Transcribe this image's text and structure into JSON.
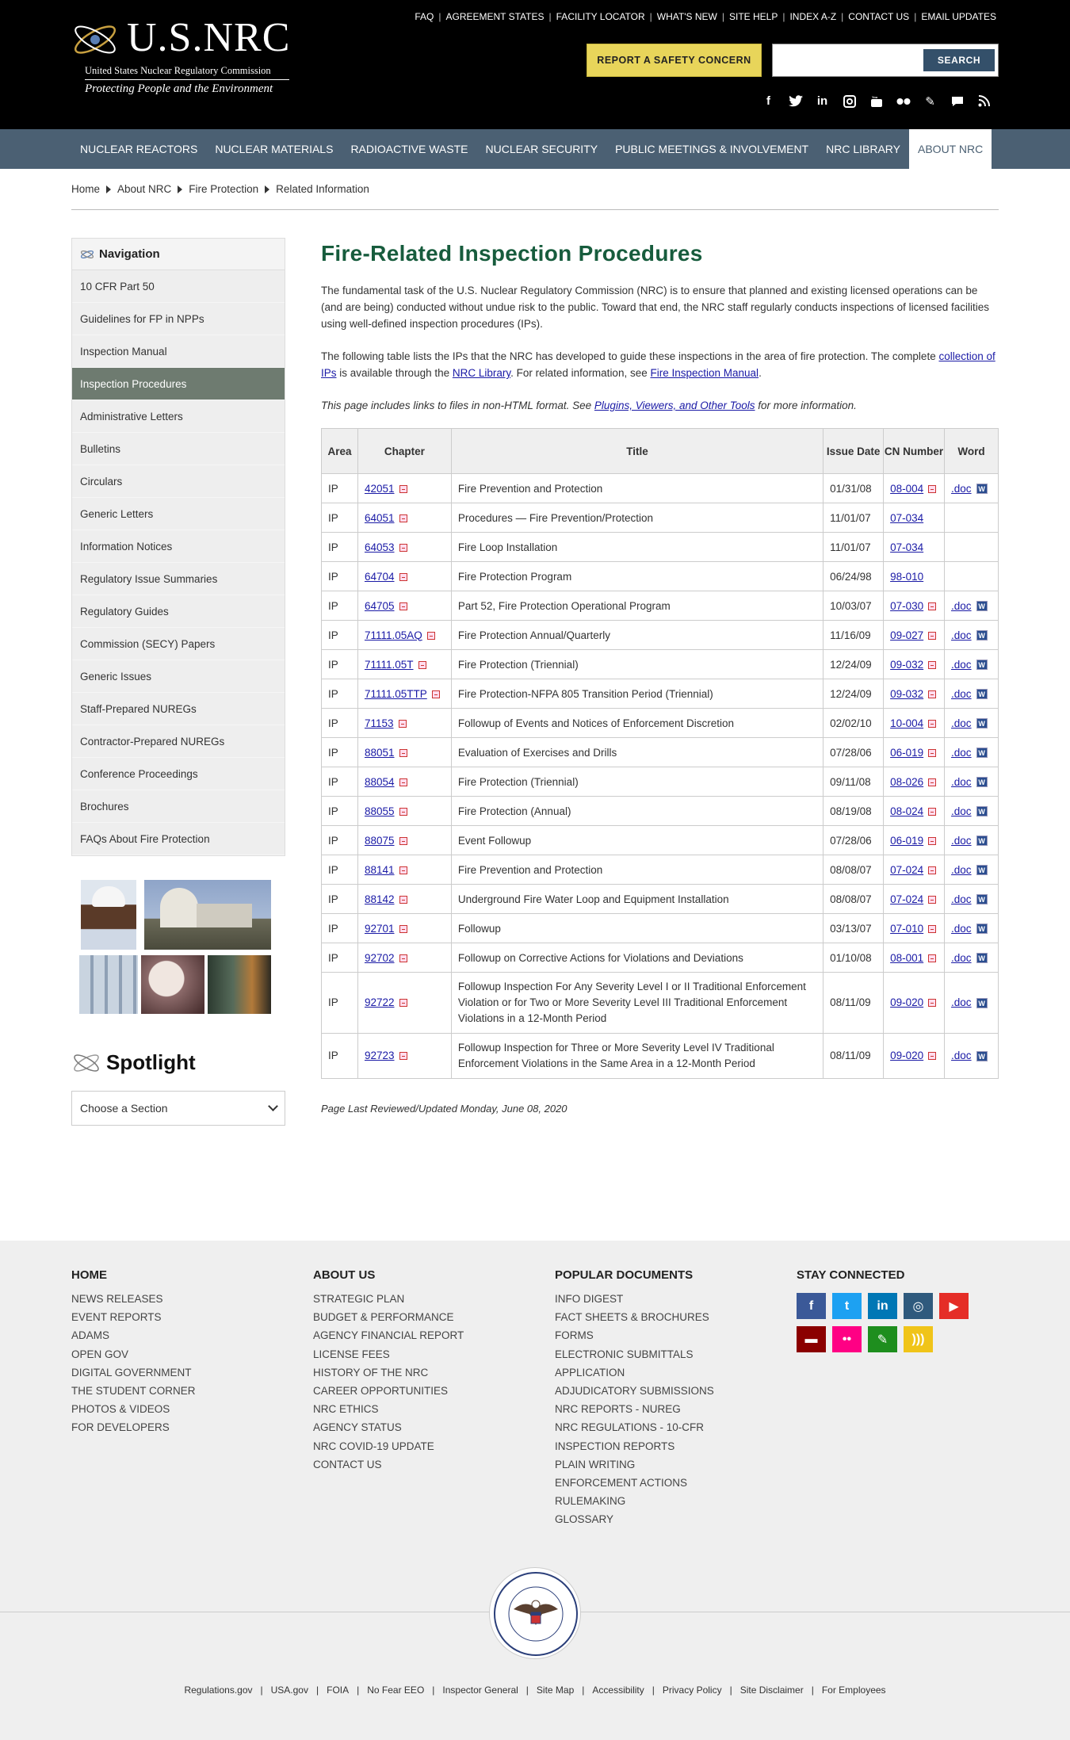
{
  "header": {
    "logo_text": "U.S.NRC",
    "logo_sub": "United States Nuclear Regulatory Commission",
    "logo_tagline": "Protecting People and the Environment",
    "top_links": [
      "FAQ",
      "AGREEMENT STATES",
      "FACILITY LOCATOR",
      "WHAT'S NEW",
      "SITE HELP",
      "INDEX A-Z",
      "CONTACT US",
      "EMAIL UPDATES"
    ],
    "report_button": "REPORT A SAFETY CONCERN",
    "search_placeholder": "",
    "search_button": "SEARCH",
    "social_icons": [
      "facebook-icon",
      "twitter-icon",
      "linkedin-icon",
      "instagram-icon",
      "youtube-icon",
      "flickr-icon",
      "pencil-icon",
      "chat-icon",
      "rss-icon"
    ]
  },
  "mainnav": [
    "NUCLEAR REACTORS",
    "NUCLEAR MATERIALS",
    "RADIOACTIVE WASTE",
    "NUCLEAR SECURITY",
    "PUBLIC MEETINGS & INVOLVEMENT",
    "NRC LIBRARY",
    "ABOUT NRC"
  ],
  "mainnav_active": "ABOUT NRC",
  "breadcrumb": [
    "Home",
    "About NRC",
    "Fire Protection",
    "Related Information"
  ],
  "sidebar": {
    "title": "Navigation",
    "items": [
      "10 CFR Part 50",
      "Guidelines for FP in NPPs",
      "Inspection Manual",
      "Inspection Procedures",
      "Administrative Letters",
      "Bulletins",
      "Circulars",
      "Generic Letters",
      "Information Notices",
      "Regulatory Issue Summaries",
      "Regulatory Guides",
      "Commission (SECY) Papers",
      "Generic Issues",
      "Staff-Prepared NUREGs",
      "Contractor-Prepared NUREGs",
      "Conference Proceedings",
      "Brochures",
      "FAQs About Fire Protection"
    ],
    "active": "Inspection Procedures",
    "spotlight_title": "Spotlight",
    "spotlight_select": "Choose a Section"
  },
  "main": {
    "title": "Fire-Related Inspection Procedures",
    "p1": "The fundamental task of the U.S. Nuclear Regulatory Commission (NRC) is to ensure that planned and existing licensed operations can be (and are being) conducted without undue risk to the public. Toward that end, the NRC staff regularly conducts inspections of licensed facilities using well-defined inspection procedures (IPs).",
    "p2_a": "The following table lists the IPs that the NRC has developed to guide these inspections in the area of fire protection. The complete ",
    "p2_link1": "collection of IPs",
    "p2_b": " is available through the ",
    "p2_link2": "NRC Library",
    "p2_c": ". For related information, see ",
    "p2_link3": "Fire Inspection Manual",
    "p2_d": ".",
    "p3_a": "This page includes links to files in non-HTML format. See ",
    "p3_link": "Plugins, Viewers, and Other Tools",
    "p3_b": " for more information.",
    "last_reviewed": "Page Last Reviewed/Updated Monday, June 08, 2020"
  },
  "table": {
    "headers": {
      "area": "Area",
      "chapter": "Chapter",
      "title": "Title",
      "issue_date": "Issue Date",
      "cn_number": "CN Number",
      "word": "Word"
    },
    "rows": [
      {
        "area": "IP",
        "chapter": "42051",
        "title": "Fire Prevention and Protection",
        "date": "01/31/08",
        "cn": "08-004",
        "cn_pdf": true,
        "word": ".doc"
      },
      {
        "area": "IP",
        "chapter": "64051",
        "title": "Procedures — Fire Prevention/Protection",
        "date": "11/01/07",
        "cn": "07-034",
        "cn_pdf": false,
        "word": ""
      },
      {
        "area": "IP",
        "chapter": "64053",
        "title": "Fire Loop Installation",
        "date": "11/01/07",
        "cn": "07-034",
        "cn_pdf": false,
        "word": ""
      },
      {
        "area": "IP",
        "chapter": "64704",
        "title": "Fire Protection Program",
        "date": "06/24/98",
        "cn": "98-010",
        "cn_pdf": false,
        "word": ""
      },
      {
        "area": "IP",
        "chapter": "64705",
        "title": "Part 52, Fire Protection Operational Program",
        "date": "10/03/07",
        "cn": "07-030",
        "cn_pdf": true,
        "word": ".doc"
      },
      {
        "area": "IP",
        "chapter": "71111.05AQ",
        "title": "Fire Protection Annual/Quarterly",
        "date": "11/16/09",
        "cn": "09-027",
        "cn_pdf": true,
        "word": ".doc"
      },
      {
        "area": "IP",
        "chapter": "71111.05T",
        "title": "Fire Protection (Triennial)",
        "date": "12/24/09",
        "cn": "09-032",
        "cn_pdf": true,
        "word": ".doc"
      },
      {
        "area": "IP",
        "chapter": "71111.05TTP",
        "title": "Fire Protection-NFPA 805 Transition Period (Triennial)",
        "date": "12/24/09",
        "cn": "09-032",
        "cn_pdf": true,
        "word": ".doc"
      },
      {
        "area": "IP",
        "chapter": "71153",
        "title": "Followup of Events and Notices of Enforcement Discretion",
        "date": "02/02/10",
        "cn": "10-004",
        "cn_pdf": true,
        "word": ".doc"
      },
      {
        "area": "IP",
        "chapter": "88051",
        "title": "Evaluation of Exercises and Drills",
        "date": "07/28/06",
        "cn": "06-019",
        "cn_pdf": true,
        "word": ".doc"
      },
      {
        "area": "IP",
        "chapter": "88054",
        "title": "Fire Protection (Triennial)",
        "date": "09/11/08",
        "cn": "08-026",
        "cn_pdf": true,
        "word": ".doc"
      },
      {
        "area": "IP",
        "chapter": "88055",
        "title": "Fire Protection (Annual)",
        "date": "08/19/08",
        "cn": "08-024",
        "cn_pdf": true,
        "word": ".doc"
      },
      {
        "area": "IP",
        "chapter": "88075",
        "title": "Event Followup",
        "date": "07/28/06",
        "cn": "06-019",
        "cn_pdf": true,
        "word": ".doc"
      },
      {
        "area": "IP",
        "chapter": "88141",
        "title": "Fire Prevention and Protection",
        "date": "08/08/07",
        "cn": "07-024",
        "cn_pdf": true,
        "word": ".doc"
      },
      {
        "area": "IP",
        "chapter": "88142",
        "title": "Underground Fire Water Loop and Equipment Installation",
        "date": "08/08/07",
        "cn": "07-024",
        "cn_pdf": true,
        "word": ".doc"
      },
      {
        "area": "IP",
        "chapter": "92701",
        "title": "Followup",
        "date": "03/13/07",
        "cn": "07-010",
        "cn_pdf": true,
        "word": ".doc"
      },
      {
        "area": "IP",
        "chapter": "92702",
        "title": "Followup on Corrective Actions for Violations and Deviations",
        "date": "01/10/08",
        "cn": "08-001",
        "cn_pdf": true,
        "word": ".doc"
      },
      {
        "area": "IP",
        "chapter": "92722",
        "title": "Followup Inspection For Any Severity Level I or II Traditional Enforcement Violation or for Two or More Severity Level III Traditional Enforcement Violations in a 12-Month Period",
        "date": "08/11/09",
        "cn": "09-020",
        "cn_pdf": true,
        "word": ".doc",
        "tall": "tall"
      },
      {
        "area": "IP",
        "chapter": "92723",
        "title": "Followup Inspection for Three or More Severity Level IV Traditional Enforcement Violations in the Same Area in a 12-Month Period",
        "date": "08/11/09",
        "cn": "09-020",
        "cn_pdf": true,
        "word": ".doc",
        "tall": "tall2"
      }
    ]
  },
  "footer": {
    "columns": [
      {
        "heading": "HOME",
        "links": [
          "NEWS RELEASES",
          "EVENT REPORTS",
          "ADAMS",
          "OPEN GOV",
          "DIGITAL GOVERNMENT",
          "THE STUDENT CORNER",
          "PHOTOS & VIDEOS",
          "FOR DEVELOPERS"
        ]
      },
      {
        "heading": "ABOUT US",
        "links": [
          "STRATEGIC PLAN",
          "BUDGET & PERFORMANCE",
          "AGENCY FINANCIAL REPORT",
          "LICENSE FEES",
          "HISTORY OF THE NRC",
          "CAREER OPPORTUNITIES",
          "NRC ETHICS",
          "AGENCY STATUS",
          "NRC COVID-19 UPDATE",
          "CONTACT US"
        ]
      },
      {
        "heading": "POPULAR DOCUMENTS",
        "links": [
          "INFO DIGEST",
          "FACT SHEETS & BROCHURES",
          "FORMS",
          "ELECTRONIC SUBMITTALS",
          "APPLICATION",
          "ADJUDICATORY SUBMISSIONS",
          "NRC REPORTS - NUREG",
          "NRC REGULATIONS - 10-CFR",
          "INSPECTION REPORTS",
          "PLAIN WRITING",
          "ENFORCEMENT ACTIONS",
          "RULEMAKING",
          "GLOSSARY"
        ]
      }
    ],
    "stay_connected": "STAY CONNECTED",
    "social": [
      {
        "name": "facebook-icon",
        "glyph": "f",
        "color": "#3b5998"
      },
      {
        "name": "twitter-icon",
        "glyph": "t",
        "color": "#1da1f2"
      },
      {
        "name": "linkedin-icon",
        "glyph": "in",
        "color": "#0077b5"
      },
      {
        "name": "instagram-icon",
        "glyph": "◎",
        "color": "#2f5a7d"
      },
      {
        "name": "youtube-icon",
        "glyph": "▶",
        "color": "#e52d27"
      },
      {
        "name": "chat-icon",
        "glyph": "▬",
        "color": "#8b0000"
      },
      {
        "name": "flickr-icon",
        "glyph": "••",
        "color": "#ff0084"
      },
      {
        "name": "pencil-icon",
        "glyph": "✎",
        "color": "#1e8e1e"
      },
      {
        "name": "rss-icon",
        "glyph": ")))",
        "color": "#f0c419"
      }
    ],
    "seal_text": "UNITED STATES NUCLEAR REGULATORY COMMISSION",
    "bottom_links": [
      "Regulations.gov",
      "USA.gov",
      "FOIA",
      "No Fear EEO",
      "Inspector General",
      "Site Map",
      "Accessibility",
      "Privacy Policy",
      "Site Disclaimer",
      "For Employees"
    ]
  }
}
